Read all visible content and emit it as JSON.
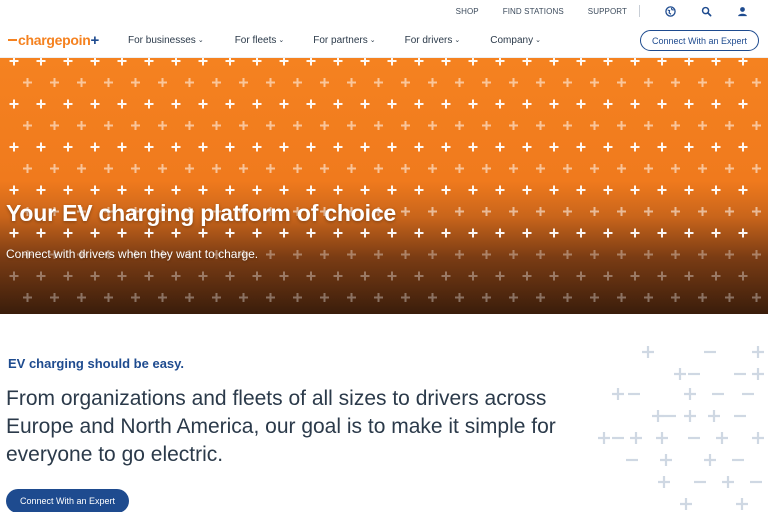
{
  "utility_bar": {
    "links": [
      "SHOP",
      "FIND STATIONS",
      "SUPPORT"
    ],
    "icons": [
      "globe-icon",
      "search-icon",
      "user-icon"
    ]
  },
  "nav": {
    "logo_text": "chargepoin",
    "logo_plus": "+",
    "items": [
      {
        "label": "For businesses"
      },
      {
        "label": "For fleets"
      },
      {
        "label": "For partners"
      },
      {
        "label": "For drivers"
      },
      {
        "label": "Company"
      }
    ],
    "cta_label": "Connect With an Expert"
  },
  "hero": {
    "title": "Your EV charging platform of choice",
    "subtitle": "Connect with drivers when they want to charge."
  },
  "intro": {
    "eyebrow": "EV charging should be easy.",
    "lede": "From organizations and fleets of all sizes to drivers across Europe and North America, our goal is to make it simple for everyone to go electric.",
    "cta_label": "Connect With an Expert"
  },
  "colors": {
    "brand_orange": "#f58220",
    "brand_blue": "#1e4b8f"
  }
}
